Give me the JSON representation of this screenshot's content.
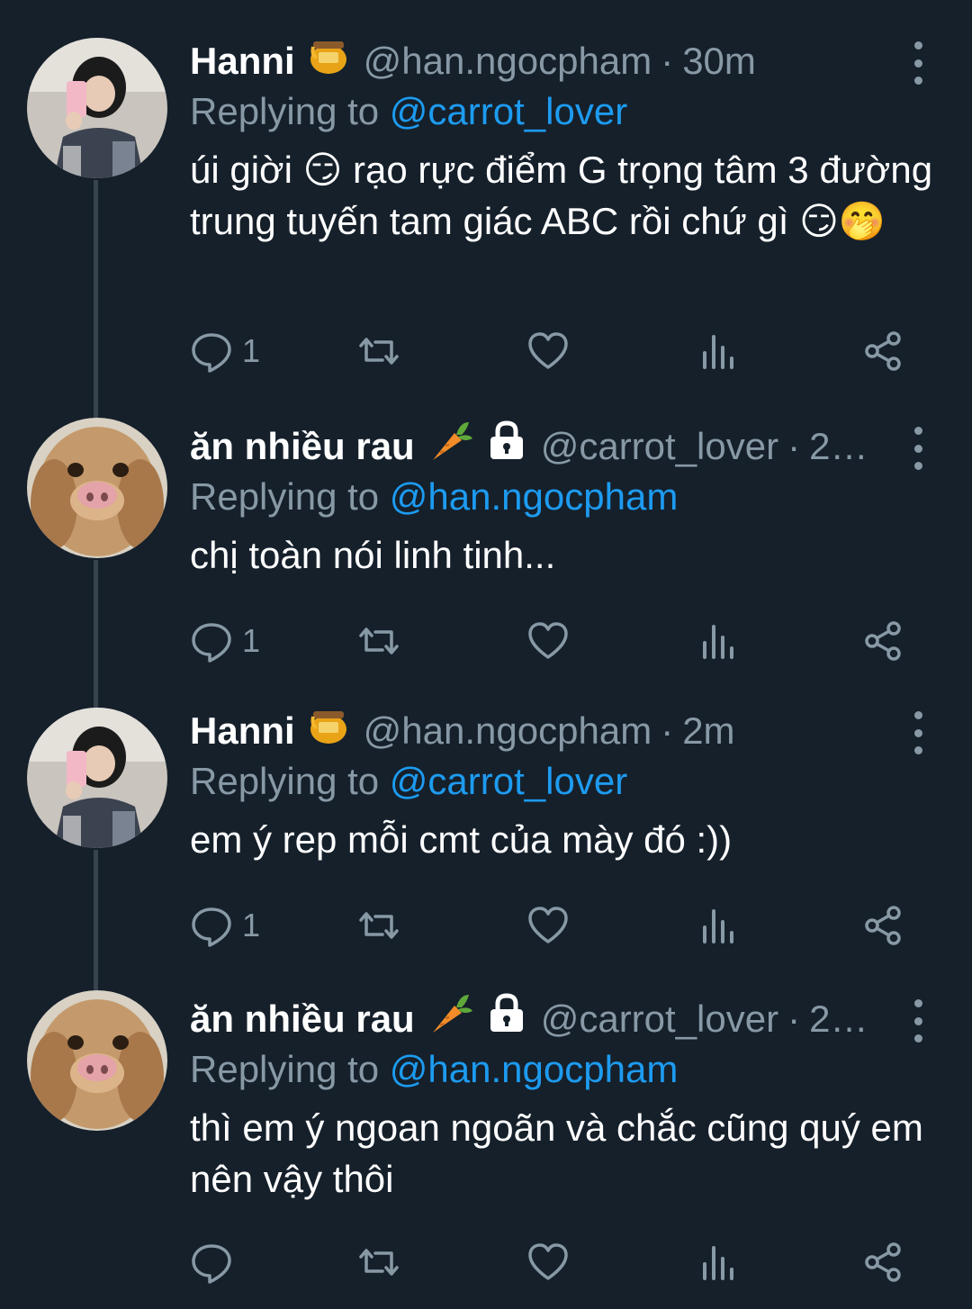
{
  "colors": {
    "background": "#15202b",
    "secondary_text": "#8899a6",
    "link": "#1d9bf0",
    "thread_line": "#38444d"
  },
  "replying_prefix": "Replying to ",
  "tweets": [
    {
      "name": "Hanni",
      "badge_icon": "honey-pot-icon",
      "handle": "@han.ngocpham",
      "separator": "·",
      "time": "30m",
      "reply_to": "@carrot_lover",
      "text": "úi giời 😏 rạo rực điểm G trọng tâm 3 đường trung tuyến tam giác ABC rồi chứ gì 😏🤭",
      "reply_count": "1",
      "avatar": "girl-avatar"
    },
    {
      "name": "ăn nhiều rau",
      "badge_icon": "carrot-icon",
      "lock_icon": "lock-icon",
      "handle": "@carrot_lover",
      "separator": "·",
      "time": "2…",
      "reply_to": "@han.ngocpham",
      "text": "chị toàn nói linh tinh...",
      "reply_count": "1",
      "avatar": "dog-avatar"
    },
    {
      "name": "Hanni",
      "badge_icon": "honey-pot-icon",
      "handle": "@han.ngocpham",
      "separator": "·",
      "time": "2m",
      "reply_to": "@carrot_lover",
      "text": "em ý rep mỗi cmt của mày đó :))",
      "reply_count": "1",
      "avatar": "girl-avatar"
    },
    {
      "name": "ăn nhiều rau",
      "badge_icon": "carrot-icon",
      "lock_icon": "lock-icon",
      "handle": "@carrot_lover",
      "separator": "·",
      "time": "2…",
      "reply_to": "@han.ngocpham",
      "text": "thì em ý ngoan ngoãn và chắc cũng quý em nên vậy thôi",
      "reply_count": "",
      "avatar": "dog-avatar"
    }
  ]
}
